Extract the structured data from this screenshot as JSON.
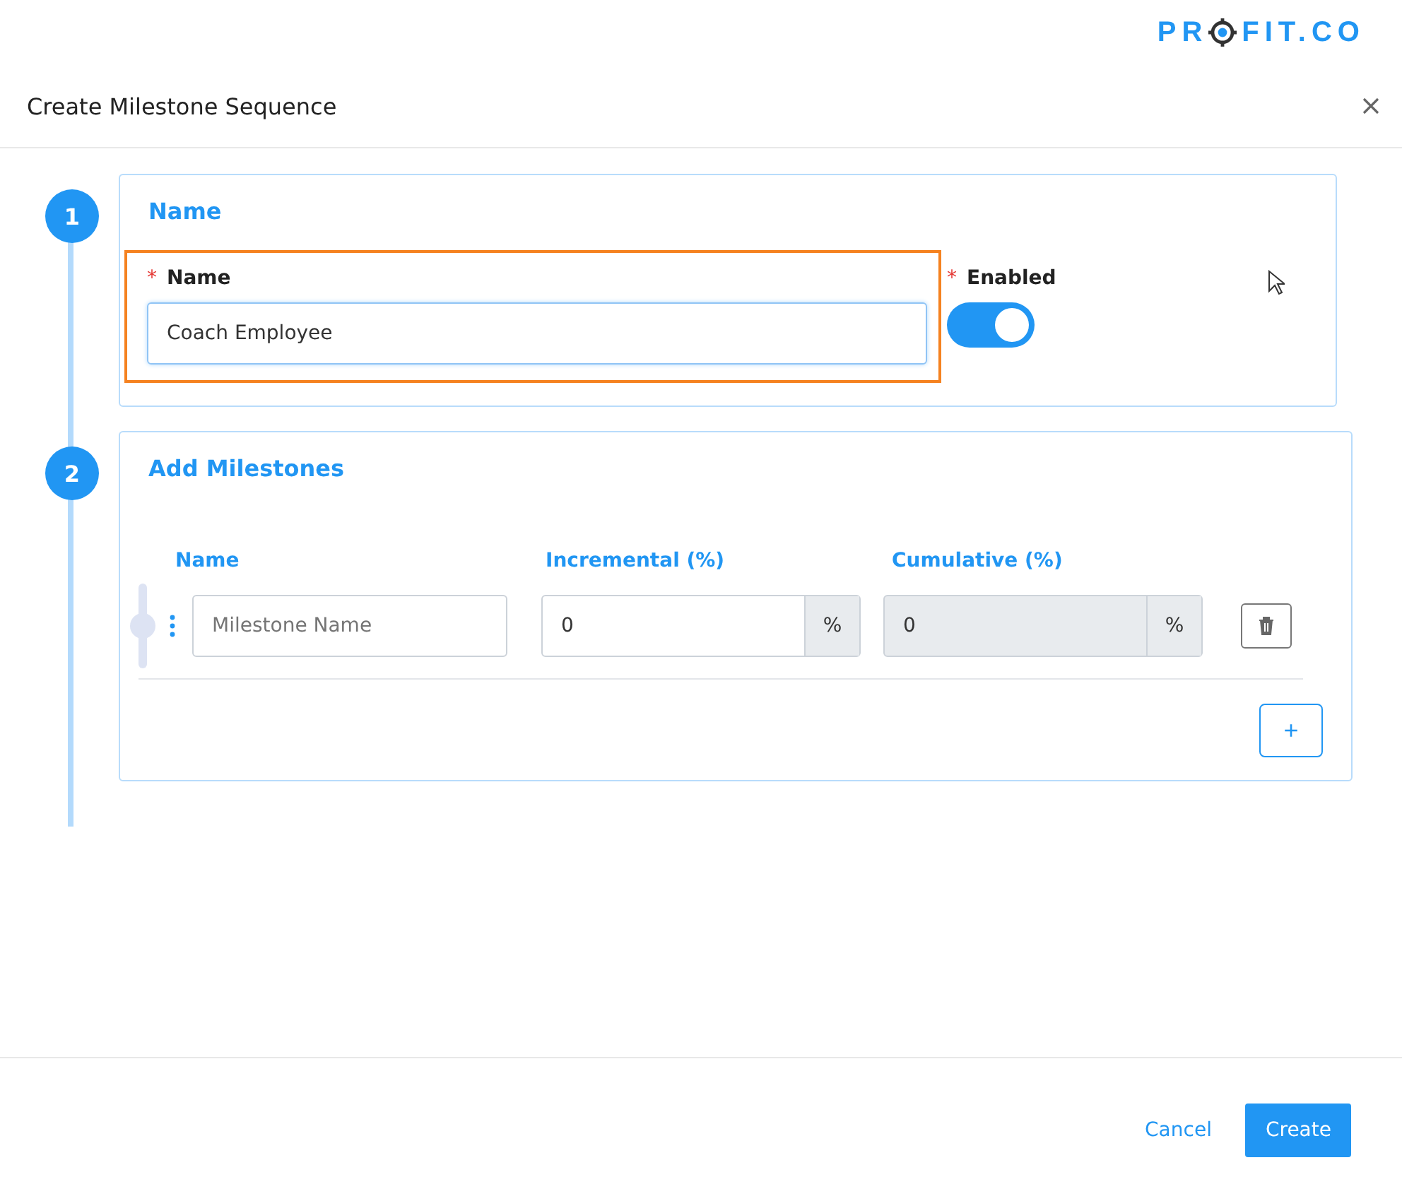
{
  "logo": {
    "before": "PR",
    "after": "FIT.CO"
  },
  "dialog": {
    "title": "Create Milestone Sequence"
  },
  "steps": [
    {
      "number": "1",
      "title": "Name"
    },
    {
      "number": "2",
      "title": "Add Milestones"
    }
  ],
  "name_section": {
    "label": "Name",
    "required_mark": "*",
    "value": "Coach Employee",
    "highlighted": true,
    "enabled_label": "Enabled",
    "enabled_required_mark": "*",
    "enabled": true
  },
  "milestones": {
    "columns": [
      "Name",
      "Incremental (%)",
      "Cumulative (%)"
    ],
    "rows": [
      {
        "name_placeholder": "Milestone Name",
        "incremental": "0",
        "incremental_unit": "%",
        "cumulative": "0",
        "cumulative_unit": "%"
      }
    ],
    "add_button": "+"
  },
  "footer": {
    "cancel": "Cancel",
    "create": "Create"
  }
}
